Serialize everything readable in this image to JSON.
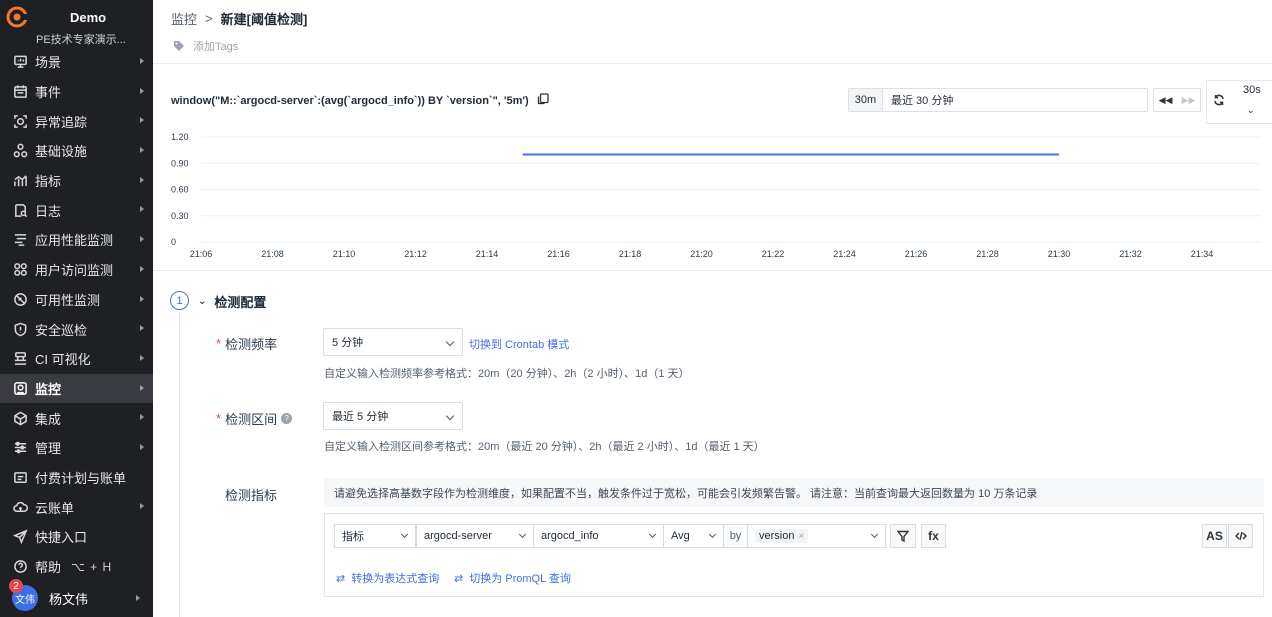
{
  "workspace": {
    "name": "Demo",
    "subtitle": "PE技术专家演示..."
  },
  "sidebar": {
    "items": [
      {
        "label": "场景",
        "icon": "monitor-icon"
      },
      {
        "label": "事件",
        "icon": "calendar-icon"
      },
      {
        "label": "异常追踪",
        "icon": "target-icon"
      },
      {
        "label": "基础设施",
        "icon": "infrastructure-icon"
      },
      {
        "label": "指标",
        "icon": "metrics-icon"
      },
      {
        "label": "日志",
        "icon": "log-icon"
      },
      {
        "label": "应用性能监测",
        "icon": "apm-icon"
      },
      {
        "label": "用户访问监测",
        "icon": "rum-icon"
      },
      {
        "label": "可用性监测",
        "icon": "availability-icon"
      },
      {
        "label": "安全巡检",
        "icon": "shield-icon"
      },
      {
        "label": "CI 可视化",
        "icon": "ci-icon"
      },
      {
        "label": "监控",
        "icon": "monitor-alert-icon"
      },
      {
        "label": "集成",
        "icon": "integration-icon"
      },
      {
        "label": "管理",
        "icon": "settings-icon"
      },
      {
        "label": "付费计划与账单",
        "icon": "billing-icon"
      },
      {
        "label": "云账单",
        "icon": "cloud-bill-icon"
      },
      {
        "label": "快捷入口",
        "icon": "send-icon"
      },
      {
        "label": "帮助",
        "icon": "help-icon",
        "shortcut": "⌥ + H"
      }
    ],
    "user": {
      "name": "杨文伟",
      "avatar_text": "文伟",
      "badge": "2"
    }
  },
  "breadcrumb": {
    "root": "监控",
    "sep": ">",
    "current": "新建[阈值检测]"
  },
  "tags": {
    "label": "添加Tags"
  },
  "query": {
    "text": "window(\"M::`argocd-server`:(avg(`argocd_info`)) BY `version`\", '5m')"
  },
  "time": {
    "short": "30m",
    "label": "最近 30 分钟",
    "refresh": "30s"
  },
  "chart_data": {
    "type": "line",
    "x": [
      "21:06",
      "21:08",
      "21:10",
      "21:12",
      "21:14",
      "21:16",
      "21:18",
      "21:20",
      "21:22",
      "21:24",
      "21:26",
      "21:28",
      "21:30",
      "21:32",
      "21:34"
    ],
    "y_ticks": [
      "0",
      "0.30",
      "0.60",
      "0.90",
      "1.20"
    ],
    "ylim": [
      0,
      1.2
    ],
    "series": [
      {
        "color": "#4f6fe0",
        "x_start": "21:15",
        "x_end": "21:30",
        "value": 1
      }
    ]
  },
  "config": {
    "step": "1",
    "title": "检测配置",
    "freq_label": "检测频率",
    "freq_value": "5 分钟",
    "freq_link": "切换到 Crontab 模式",
    "freq_hint": "自定义输入检测频率参考格式：20m（20 分钟）、2h（2 小时）、1d（1 天）",
    "range_label": "检测区间",
    "range_value": "最近 5 分钟",
    "range_hint": "自定义输入检测区间参考格式：20m（最近 20 分钟）、2h（最近 2 小时）、1d（最近 1 天）",
    "metric_label": "检测指标",
    "notice": "请避免选择高基数字段作为检测维度，如果配置不当，触发条件过于宽松，可能会引发频繁告警。 请注意：当前查询最大返回数量为 10 万条记录",
    "source_type": "指标",
    "measurement": "argocd-server",
    "field": "argocd_info",
    "agg": "Avg",
    "by": "by",
    "group_tag": "version",
    "fx": "fx",
    "as": "AS",
    "switch_expr": "转换为表达式查询",
    "switch_promql": "切换为 PromQL 查询"
  },
  "colors": {
    "accent": "#3f6ee8",
    "sidebar_bg": "#1f2024",
    "required": "#e8473c"
  }
}
